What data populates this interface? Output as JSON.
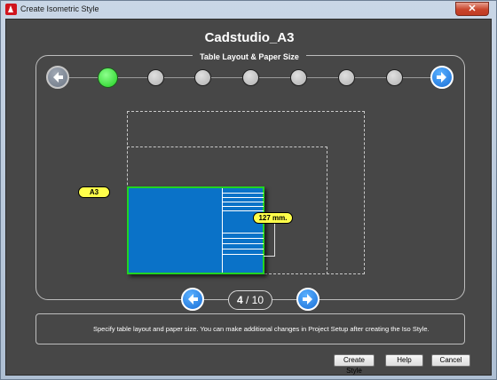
{
  "window": {
    "title": "Create Isometric Style",
    "close_glyph": "✕"
  },
  "dialog": {
    "style_name": "Cadstudio_A3",
    "step_title": "Table Layout & Paper Size",
    "steps_total_dots": 7,
    "active_step_dot": 1
  },
  "preview": {
    "paper_label": "A3",
    "dimension_label": "127 mm."
  },
  "pager": {
    "current": "4",
    "separator": "/",
    "total": "10"
  },
  "description": "Specify table layout and paper size.  You can make additional changes in Project Setup after creating the Iso Style.",
  "buttons": {
    "create_style": "Create Style",
    "help": "Help",
    "cancel": "Cancel"
  },
  "colors": {
    "background": "#474747",
    "active_step": "#33dd33",
    "paper_fill": "#0a72c8",
    "paper_border": "#22d322",
    "tag_fill": "#ffff4a",
    "nav_arrow": "#1a6fd6"
  },
  "icons": {
    "top_prev": "arrow-left-icon",
    "top_next": "arrow-right-icon",
    "bottom_prev": "arrow-left-icon",
    "bottom_next": "arrow-right-icon"
  }
}
